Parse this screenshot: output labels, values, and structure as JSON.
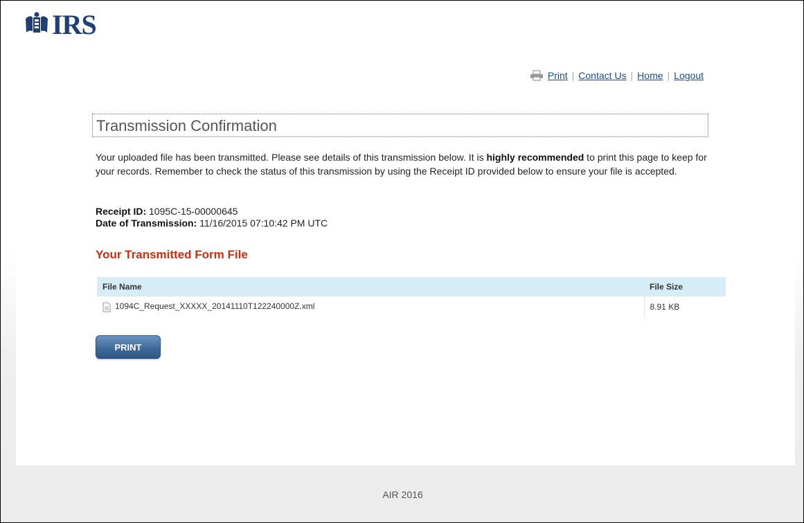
{
  "header": {
    "logo_text": "IRS",
    "links": {
      "print": "Print",
      "contact": "Contact Us",
      "home": "Home",
      "logout": "Logout"
    }
  },
  "main": {
    "title": "Transmission Confirmation",
    "intro_part1": "Your uploaded file has been transmitted. Please see details of this transmission below. It is ",
    "intro_bold": "highly recommended",
    "intro_part2": " to print this page to keep for your records. Remember to check the status of this transmission by using the Receipt ID provided below to ensure your file is accepted.",
    "receipt_label": "Receipt ID:",
    "receipt_value": " 1095C-15-00000645",
    "date_label": "Date of Transmission:",
    "date_value": " 11/16/2015 07:10:42 PM UTC",
    "section_title": "Your Transmitted Form File",
    "table": {
      "headers": [
        "File Name",
        "File Size"
      ],
      "rows": [
        {
          "name": "1094C_Request_XXXXX_20141110T122240000Z.xml",
          "size": "8.91 KB"
        }
      ]
    },
    "print_button": "PRINT"
  },
  "footer": {
    "text": "AIR 2016"
  },
  "colors": {
    "link": "#1a4b9c",
    "section_title": "#d32a0c",
    "table_header_bg": "#d6ecf7",
    "button": "#3f6a9a"
  }
}
